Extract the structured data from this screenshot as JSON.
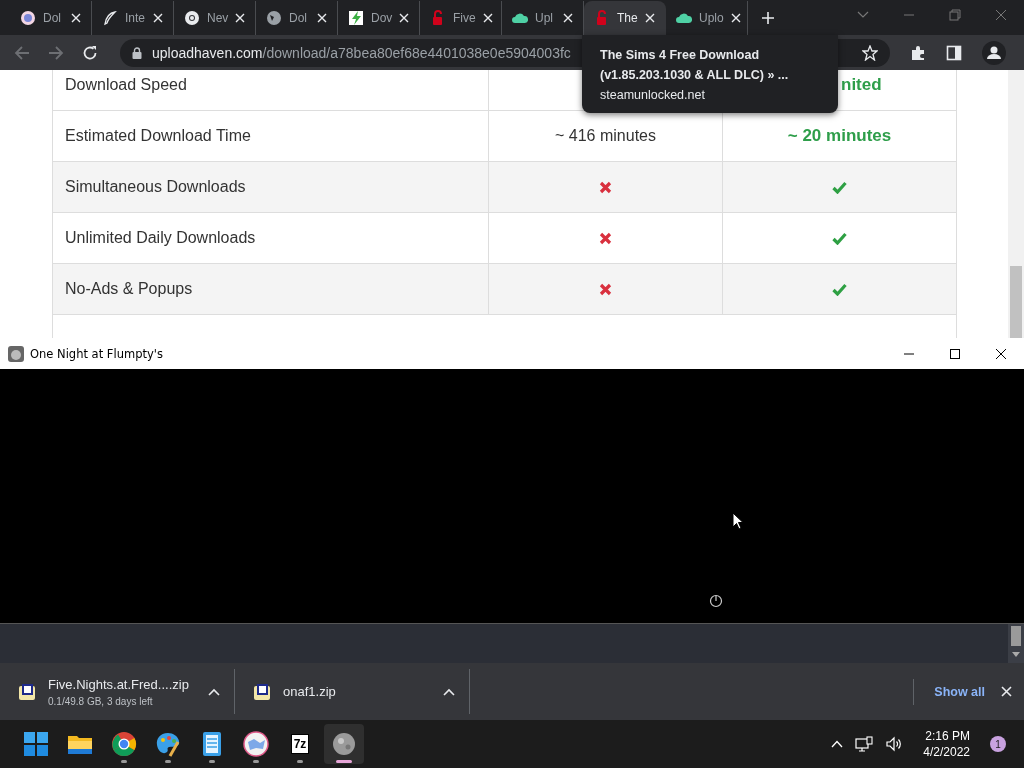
{
  "browser": {
    "tabs": [
      {
        "label": "Dol",
        "selected": false
      },
      {
        "label": "Inte",
        "selected": false
      },
      {
        "label": "Nev",
        "selected": false
      },
      {
        "label": "Dol",
        "selected": false
      },
      {
        "label": "Dov",
        "selected": false
      },
      {
        "label": "Five",
        "selected": false
      },
      {
        "label": "Upl",
        "selected": false
      },
      {
        "label": "The",
        "selected": true
      },
      {
        "label": "Uplo",
        "selected": false
      }
    ],
    "address": {
      "host": "uploadhaven.com",
      "path": "/download/a78bea80ef68e4401038e0e5904003fc"
    },
    "tooltip": {
      "title": "The Sims 4 Free Download (v1.85.203.1030 & ALL DLC) » ...",
      "host": "steamunlocked.net"
    },
    "table": {
      "rows": [
        {
          "feature": "Download Speed",
          "premium": {
            "kind": "text",
            "text": "nited"
          }
        },
        {
          "feature": "Estimated Download Time",
          "free": {
            "kind": "text",
            "text": "~ 416 minutes"
          },
          "premium": {
            "kind": "text",
            "text": "~ 20 minutes"
          }
        },
        {
          "feature": "Simultaneous Downloads",
          "free": {
            "kind": "cross"
          },
          "premium": {
            "kind": "check"
          }
        },
        {
          "feature": "Unlimited Daily Downloads",
          "free": {
            "kind": "cross"
          },
          "premium": {
            "kind": "check"
          }
        },
        {
          "feature": "No-Ads & Popups",
          "free": {
            "kind": "cross"
          },
          "premium": {
            "kind": "check"
          }
        }
      ]
    },
    "downloads": [
      {
        "name": "Five.Nights.at.Fred....zip",
        "detail": "0.1/49.8 GB, 3 days left"
      },
      {
        "name": "onaf1.zip"
      }
    ],
    "show_all": "Show all"
  },
  "game_window": {
    "title": "One Night at Flumpty's"
  },
  "taskbar": {
    "apps": [
      {
        "kind": "start",
        "running": false,
        "selected": false
      },
      {
        "kind": "folder",
        "running": false,
        "selected": false
      },
      {
        "kind": "chrome",
        "running": true,
        "selected": false
      },
      {
        "kind": "paint",
        "running": true,
        "selected": false
      },
      {
        "kind": "notepad",
        "running": true,
        "selected": false
      },
      {
        "kind": "app",
        "running": true,
        "selected": false
      },
      {
        "kind": "archive",
        "text": "7z",
        "running": true,
        "selected": false
      },
      {
        "kind": "game",
        "running": true,
        "selected": true
      }
    ],
    "time": "2:16 PM",
    "date": "4/2/2022",
    "notifications": "1"
  }
}
